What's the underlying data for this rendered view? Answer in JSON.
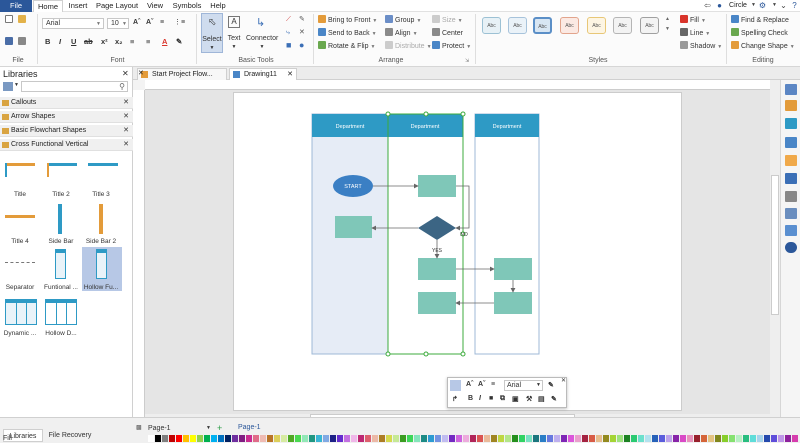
{
  "menubar": {
    "file": "File",
    "items": [
      "Home",
      "Insert",
      "Page Layout",
      "View",
      "Symbols",
      "Help"
    ],
    "user": "Circle"
  },
  "ribbon": {
    "font_name": "Arial",
    "font_size": "10",
    "groups": {
      "file": "File",
      "font": "Font",
      "basic_tools": "Basic Tools",
      "arrange": "Arrange",
      "styles": "Styles",
      "editing": "Editing"
    },
    "tools": {
      "select": "Select",
      "text": "Text",
      "connector": "Connector"
    },
    "arrange": {
      "bring_front": "Bring to Front",
      "send_back": "Send to Back",
      "rotate_flip": "Rotate & Flip",
      "group": "Group",
      "align": "Align",
      "distribute": "Distribute",
      "size": "Size",
      "center": "Center",
      "protect": "Protect"
    },
    "style_swatch_label": "Abc",
    "format": {
      "fill": "Fill",
      "line": "Line",
      "shadow": "Shadow"
    },
    "editing": {
      "find_replace": "Find & Replace",
      "spelling": "Spelling Check",
      "change_shape": "Change Shape"
    }
  },
  "libraries": {
    "title": "Libraries",
    "sections": [
      "Callouts",
      "Arrow Shapes",
      "Basic Flowchart Shapes",
      "Cross Functional Vertical"
    ],
    "shapes": [
      "Title",
      "Title 2",
      "Title 3",
      "Title 4",
      "Side Bar",
      "Side Bar 2",
      "Separator",
      "Funtional ...",
      "Hollow Fu...",
      "Dynamic ...",
      "Hollow D..."
    ]
  },
  "tabs": [
    "Start Project Flow...",
    "Drawing11"
  ],
  "diagram": {
    "lane_header": "Department",
    "start": "START",
    "yes": "YES",
    "no": "NO"
  },
  "floatbar": {
    "font": "Arial"
  },
  "bottom": {
    "tabs": [
      "Libraries",
      "File Recovery"
    ],
    "page_select": "Page-1",
    "page_tab": "Page-1",
    "fill_label": "Fill"
  },
  "colors": {
    "lane_header": "#2e9ac5",
    "process": "#7fc7b8",
    "start": "#3b7fc4",
    "decision": "#3c6584",
    "accent": "#2b579a"
  }
}
